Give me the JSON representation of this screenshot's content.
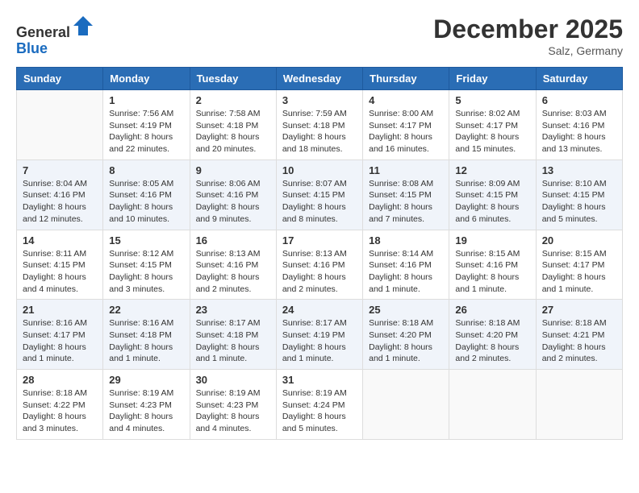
{
  "header": {
    "logo_general": "General",
    "logo_blue": "Blue",
    "month_title": "December 2025",
    "subtitle": "Salz, Germany"
  },
  "calendar": {
    "days_of_week": [
      "Sunday",
      "Monday",
      "Tuesday",
      "Wednesday",
      "Thursday",
      "Friday",
      "Saturday"
    ],
    "weeks": [
      [
        {
          "day": "",
          "sunrise": "",
          "sunset": "",
          "daylight": "",
          "empty": true
        },
        {
          "day": "1",
          "sunrise": "Sunrise: 7:56 AM",
          "sunset": "Sunset: 4:19 PM",
          "daylight": "Daylight: 8 hours and 22 minutes."
        },
        {
          "day": "2",
          "sunrise": "Sunrise: 7:58 AM",
          "sunset": "Sunset: 4:18 PM",
          "daylight": "Daylight: 8 hours and 20 minutes."
        },
        {
          "day": "3",
          "sunrise": "Sunrise: 7:59 AM",
          "sunset": "Sunset: 4:18 PM",
          "daylight": "Daylight: 8 hours and 18 minutes."
        },
        {
          "day": "4",
          "sunrise": "Sunrise: 8:00 AM",
          "sunset": "Sunset: 4:17 PM",
          "daylight": "Daylight: 8 hours and 16 minutes."
        },
        {
          "day": "5",
          "sunrise": "Sunrise: 8:02 AM",
          "sunset": "Sunset: 4:17 PM",
          "daylight": "Daylight: 8 hours and 15 minutes."
        },
        {
          "day": "6",
          "sunrise": "Sunrise: 8:03 AM",
          "sunset": "Sunset: 4:16 PM",
          "daylight": "Daylight: 8 hours and 13 minutes."
        }
      ],
      [
        {
          "day": "7",
          "sunrise": "Sunrise: 8:04 AM",
          "sunset": "Sunset: 4:16 PM",
          "daylight": "Daylight: 8 hours and 12 minutes."
        },
        {
          "day": "8",
          "sunrise": "Sunrise: 8:05 AM",
          "sunset": "Sunset: 4:16 PM",
          "daylight": "Daylight: 8 hours and 10 minutes."
        },
        {
          "day": "9",
          "sunrise": "Sunrise: 8:06 AM",
          "sunset": "Sunset: 4:16 PM",
          "daylight": "Daylight: 8 hours and 9 minutes."
        },
        {
          "day": "10",
          "sunrise": "Sunrise: 8:07 AM",
          "sunset": "Sunset: 4:15 PM",
          "daylight": "Daylight: 8 hours and 8 minutes."
        },
        {
          "day": "11",
          "sunrise": "Sunrise: 8:08 AM",
          "sunset": "Sunset: 4:15 PM",
          "daylight": "Daylight: 8 hours and 7 minutes."
        },
        {
          "day": "12",
          "sunrise": "Sunrise: 8:09 AM",
          "sunset": "Sunset: 4:15 PM",
          "daylight": "Daylight: 8 hours and 6 minutes."
        },
        {
          "day": "13",
          "sunrise": "Sunrise: 8:10 AM",
          "sunset": "Sunset: 4:15 PM",
          "daylight": "Daylight: 8 hours and 5 minutes."
        }
      ],
      [
        {
          "day": "14",
          "sunrise": "Sunrise: 8:11 AM",
          "sunset": "Sunset: 4:15 PM",
          "daylight": "Daylight: 8 hours and 4 minutes."
        },
        {
          "day": "15",
          "sunrise": "Sunrise: 8:12 AM",
          "sunset": "Sunset: 4:15 PM",
          "daylight": "Daylight: 8 hours and 3 minutes."
        },
        {
          "day": "16",
          "sunrise": "Sunrise: 8:13 AM",
          "sunset": "Sunset: 4:16 PM",
          "daylight": "Daylight: 8 hours and 2 minutes."
        },
        {
          "day": "17",
          "sunrise": "Sunrise: 8:13 AM",
          "sunset": "Sunset: 4:16 PM",
          "daylight": "Daylight: 8 hours and 2 minutes."
        },
        {
          "day": "18",
          "sunrise": "Sunrise: 8:14 AM",
          "sunset": "Sunset: 4:16 PM",
          "daylight": "Daylight: 8 hours and 1 minute."
        },
        {
          "day": "19",
          "sunrise": "Sunrise: 8:15 AM",
          "sunset": "Sunset: 4:16 PM",
          "daylight": "Daylight: 8 hours and 1 minute."
        },
        {
          "day": "20",
          "sunrise": "Sunrise: 8:15 AM",
          "sunset": "Sunset: 4:17 PM",
          "daylight": "Daylight: 8 hours and 1 minute."
        }
      ],
      [
        {
          "day": "21",
          "sunrise": "Sunrise: 8:16 AM",
          "sunset": "Sunset: 4:17 PM",
          "daylight": "Daylight: 8 hours and 1 minute."
        },
        {
          "day": "22",
          "sunrise": "Sunrise: 8:16 AM",
          "sunset": "Sunset: 4:18 PM",
          "daylight": "Daylight: 8 hours and 1 minute."
        },
        {
          "day": "23",
          "sunrise": "Sunrise: 8:17 AM",
          "sunset": "Sunset: 4:18 PM",
          "daylight": "Daylight: 8 hours and 1 minute."
        },
        {
          "day": "24",
          "sunrise": "Sunrise: 8:17 AM",
          "sunset": "Sunset: 4:19 PM",
          "daylight": "Daylight: 8 hours and 1 minute."
        },
        {
          "day": "25",
          "sunrise": "Sunrise: 8:18 AM",
          "sunset": "Sunset: 4:20 PM",
          "daylight": "Daylight: 8 hours and 1 minute."
        },
        {
          "day": "26",
          "sunrise": "Sunrise: 8:18 AM",
          "sunset": "Sunset: 4:20 PM",
          "daylight": "Daylight: 8 hours and 2 minutes."
        },
        {
          "day": "27",
          "sunrise": "Sunrise: 8:18 AM",
          "sunset": "Sunset: 4:21 PM",
          "daylight": "Daylight: 8 hours and 2 minutes."
        }
      ],
      [
        {
          "day": "28",
          "sunrise": "Sunrise: 8:18 AM",
          "sunset": "Sunset: 4:22 PM",
          "daylight": "Daylight: 8 hours and 3 minutes."
        },
        {
          "day": "29",
          "sunrise": "Sunrise: 8:19 AM",
          "sunset": "Sunset: 4:23 PM",
          "daylight": "Daylight: 8 hours and 4 minutes."
        },
        {
          "day": "30",
          "sunrise": "Sunrise: 8:19 AM",
          "sunset": "Sunset: 4:23 PM",
          "daylight": "Daylight: 8 hours and 4 minutes."
        },
        {
          "day": "31",
          "sunrise": "Sunrise: 8:19 AM",
          "sunset": "Sunset: 4:24 PM",
          "daylight": "Daylight: 8 hours and 5 minutes."
        },
        {
          "day": "",
          "empty": true
        },
        {
          "day": "",
          "empty": true
        },
        {
          "day": "",
          "empty": true
        }
      ]
    ]
  }
}
